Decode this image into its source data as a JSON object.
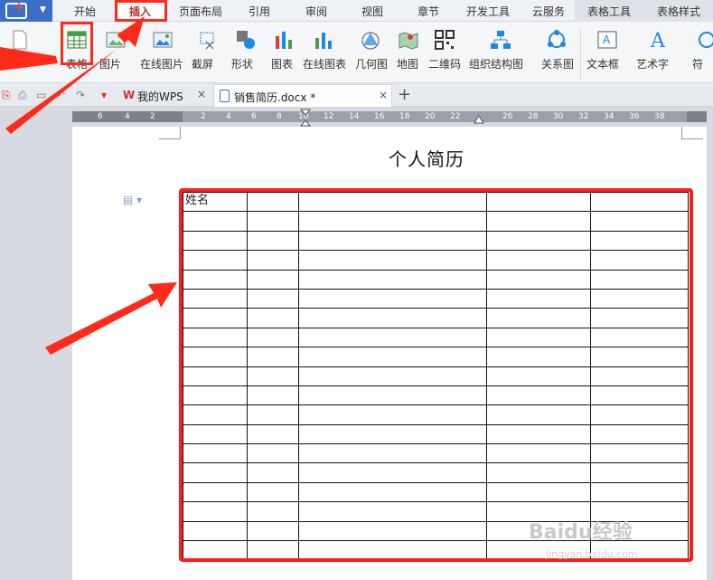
{
  "menu": {
    "tabs": [
      "开始",
      "插入",
      "页面布局",
      "引用",
      "审阅",
      "视图",
      "章节",
      "开发工具",
      "云服务",
      "表格工具",
      "表格样式"
    ],
    "active": "插入"
  },
  "ribbon": {
    "items": [
      {
        "label": "空白页",
        "icon": "blank-page-icon"
      },
      {
        "label": "表格",
        "icon": "table-icon"
      },
      {
        "label": "图片",
        "icon": "picture-icon"
      },
      {
        "label": "在线图片",
        "icon": "online-picture-icon"
      },
      {
        "label": "截屏",
        "icon": "screenshot-icon"
      },
      {
        "label": "形状",
        "icon": "shapes-icon"
      },
      {
        "label": "图表",
        "icon": "chart-icon"
      },
      {
        "label": "在线图表",
        "icon": "online-chart-icon"
      },
      {
        "label": "几何图",
        "icon": "geometry-icon"
      },
      {
        "label": "地图",
        "icon": "map-icon"
      },
      {
        "label": "二维码",
        "icon": "qrcode-icon"
      },
      {
        "label": "组织结构图",
        "icon": "org-chart-icon"
      },
      {
        "label": "关系图",
        "icon": "relation-icon"
      },
      {
        "label": "文本框",
        "icon": "textbox-icon"
      },
      {
        "label": "艺术字",
        "icon": "wordart-icon"
      },
      {
        "label": "符",
        "icon": "symbol-icon"
      }
    ]
  },
  "doc_tabs": {
    "wps_label": "我的WPS",
    "doc_label": "销售简历.docx *",
    "close_glyph": "×",
    "new_glyph": "+"
  },
  "ruler": {
    "numbers": [
      "6",
      "4",
      "2",
      "2",
      "4",
      "6",
      "8",
      "10",
      "12",
      "14",
      "16",
      "18",
      "20",
      "22",
      "26",
      "28",
      "30",
      "32",
      "34",
      "36",
      "38"
    ]
  },
  "document": {
    "title": "个人简历",
    "table": {
      "first_cell": "姓名",
      "rows": 19,
      "cols": 5
    }
  },
  "watermark": {
    "text": "Baidu经验",
    "url_text": "jingyan.baidu.com"
  },
  "colors": {
    "accent": "#ff1c1c",
    "app_blue": "#3b6fc5",
    "active_tab": "#c62828"
  }
}
